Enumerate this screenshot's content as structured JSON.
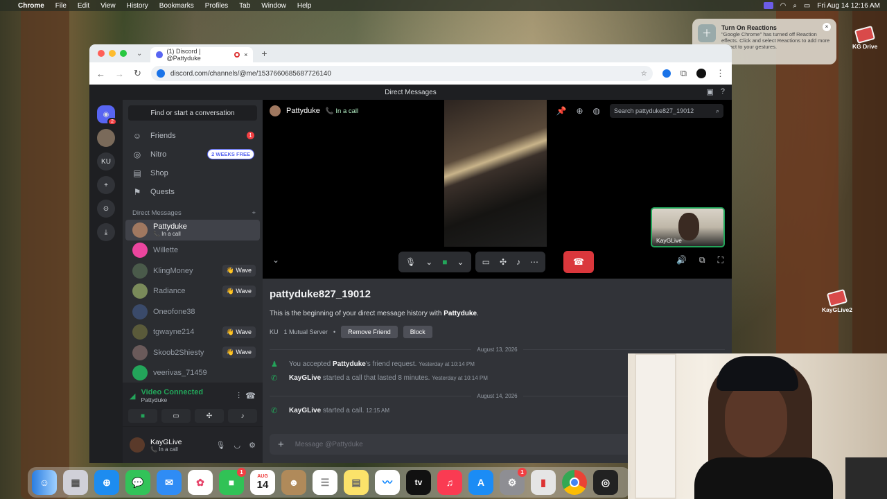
{
  "menubar": {
    "items": [
      "Chrome",
      "File",
      "Edit",
      "View",
      "History",
      "Bookmarks",
      "Profiles",
      "Tab",
      "Window",
      "Help"
    ],
    "clock": "Fri Aug 14  12:16 AM"
  },
  "browser": {
    "tab_title": "(1) Discord | @Pattyduke",
    "url": "discord.com/channels/@me/1537660685687726140"
  },
  "notification": {
    "title": "Turn On Reactions",
    "body": "\"Google Chrome\" has turned off Reaction effects. Click and select Reactions to add more impact to your gestures."
  },
  "desktop": {
    "icon1": "KG Drive",
    "icon2": "KayGLive2"
  },
  "discord": {
    "title": "Direct Messages",
    "guild_ku": "KU",
    "home_badge": "2",
    "find_placeholder": "Find or start a conversation",
    "nav": [
      {
        "label": "Friends",
        "icon": "friends-icon",
        "badge": "1"
      },
      {
        "label": "Nitro",
        "icon": "nitro-icon",
        "badge": "2 WEEKS FREE"
      },
      {
        "label": "Shop",
        "icon": "shop-icon"
      },
      {
        "label": "Quests",
        "icon": "quests-icon"
      }
    ],
    "dm_header": "Direct Messages",
    "wave_label": "👋 Wave",
    "dms": [
      {
        "name": "Pattyduke",
        "sub": "📞 In a call",
        "color": "#a07860"
      },
      {
        "name": "Willette",
        "color": "#eb459e"
      },
      {
        "name": "KlingMoney",
        "color": "#4a5a4a"
      },
      {
        "name": "Radiance",
        "color": "#7a8a5a"
      },
      {
        "name": "Oneofone38",
        "color": "#3a4a6a"
      },
      {
        "name": "tgwayne214",
        "color": "#5a5a3a"
      },
      {
        "name": "Skoob2Shiesty",
        "color": "#6a5a5a"
      },
      {
        "name": "veerivas_71459",
        "color": "#23a55a"
      }
    ],
    "voice": {
      "title": "Video Connected",
      "sub": "Pattyduke"
    },
    "user": {
      "name": "KayGLive",
      "status": "📞 In a call"
    },
    "call": {
      "name": "Pattyduke",
      "status": "In a call",
      "search_placeholder": "Search pattyduke827_19012",
      "self_label": "KayGLive"
    },
    "chat": {
      "username": "pattyduke827_19012",
      "begin_prefix": "This is the beginning of your direct message history with ",
      "begin_name": "Pattyduke",
      "begin_suffix": ".",
      "mutual_tag": "KU",
      "mutual": "1 Mutual Server",
      "remove_friend": "Remove Friend",
      "block": "Block",
      "date1": "August 13, 2026",
      "msg1_prefix": "You accepted ",
      "msg1_name": "Pattyduke",
      "msg1_suffix": "'s friend request.",
      "msg1_time": "Yesterday at 10:14 PM",
      "msg2_name": "KayGLive",
      "msg2_text": " started a call that lasted 8 minutes.",
      "msg2_time": "Yesterday at 10:14 PM",
      "date2": "August 14, 2026",
      "msg3_name": "KayGLive",
      "msg3_text": " started a call.",
      "msg3_time": "12:15 AM",
      "message_placeholder": "Message @Pattyduke"
    }
  },
  "dock": {
    "calendar_month": "AUG",
    "calendar_day": "14",
    "facetime_badge": "1",
    "settings_badge": "1",
    "appletv_label": "tv"
  }
}
